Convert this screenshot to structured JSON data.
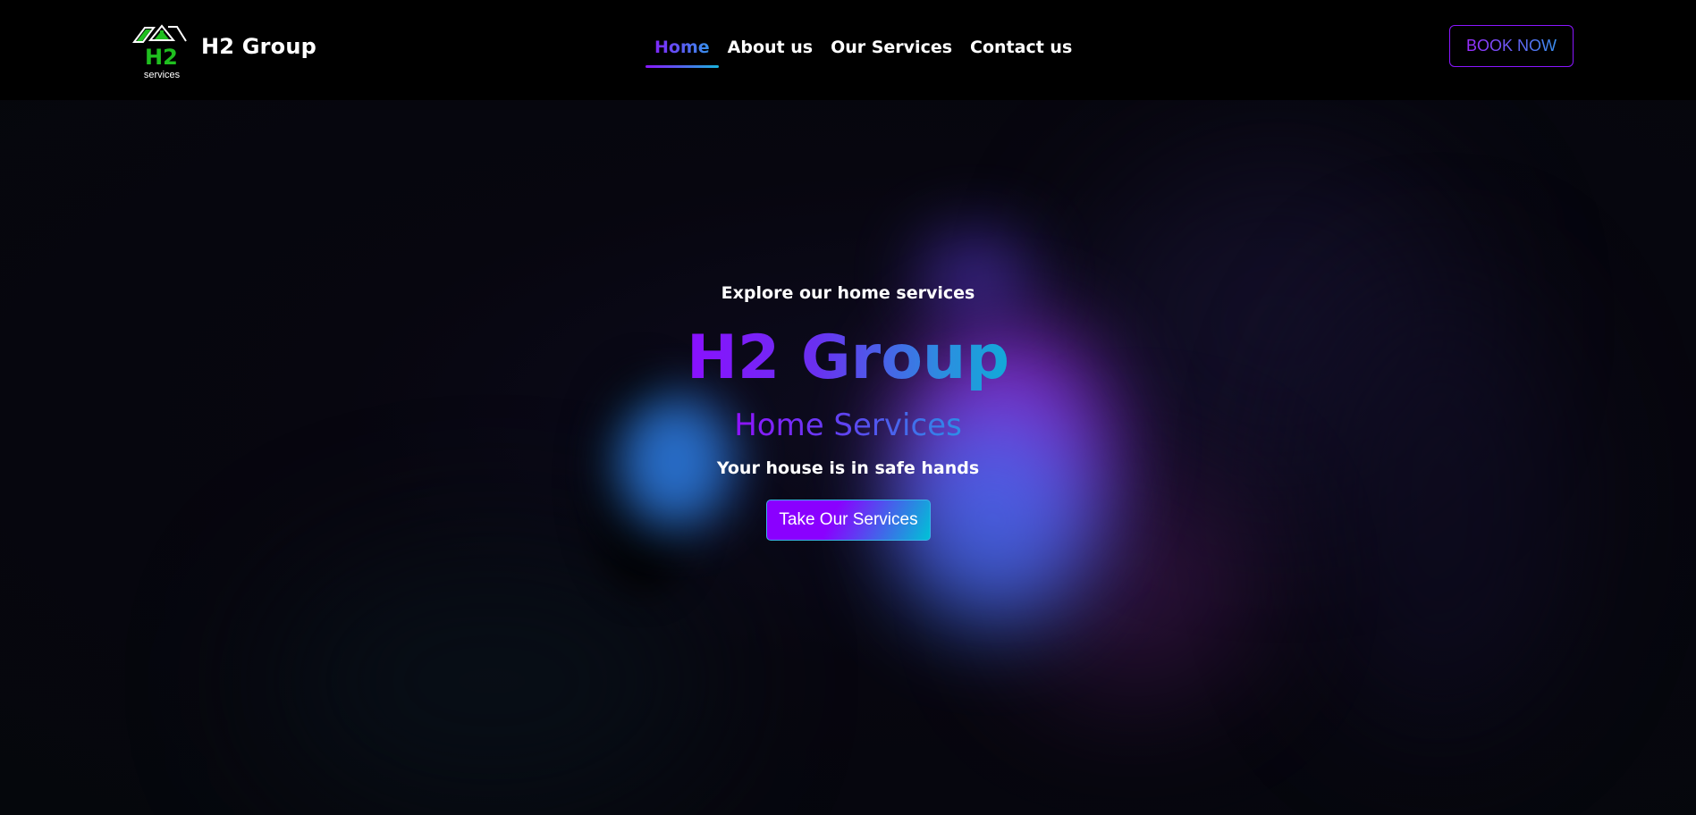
{
  "header": {
    "logo": {
      "text": "H2",
      "subtext": "services",
      "icon": "house-roof-logo-icon"
    },
    "brand_name": "H2 Group",
    "nav": [
      {
        "label": "Home",
        "active": true
      },
      {
        "label": "About us",
        "active": false
      },
      {
        "label": "Our Services",
        "active": false
      },
      {
        "label": "Contact us",
        "active": false
      }
    ],
    "book_button": "BOOK NOW"
  },
  "hero": {
    "eyebrow": "Explore our home services",
    "title": "H2 Group",
    "subtitle": "Home Services",
    "tagline": "Your house is in safe hands",
    "cta": "Take Our Services"
  },
  "colors": {
    "navbar_bg": "#000000",
    "accent_purple": "#8a10ff",
    "accent_cyan": "#12aad8",
    "logo_green": "#1fbf1f"
  }
}
